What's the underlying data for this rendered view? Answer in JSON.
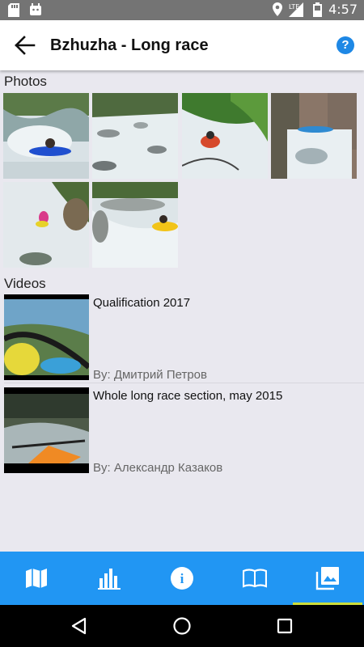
{
  "status": {
    "time": "4:57",
    "network": "LTE"
  },
  "appbar": {
    "title": "Bzhuzha - Long race",
    "help_label": "?"
  },
  "photos": {
    "label": "Photos",
    "items": [
      {
        "alt": "Kayaker in blue boat paddling whitewater"
      },
      {
        "alt": "Rapids flowing through forest"
      },
      {
        "alt": "Kayaker under trees in rapids"
      },
      {
        "alt": "Waterfall with kayakers"
      },
      {
        "alt": "Kayaker in white water"
      },
      {
        "alt": "Kayaker in yellow boat in rapids"
      }
    ]
  },
  "videos": {
    "label": "Videos",
    "items": [
      {
        "title": "Qualification 2017",
        "author": "By: Дмитрий Петров"
      },
      {
        "title": "Whole long race section, may 2015",
        "author": "By: Александр Казаков"
      }
    ]
  },
  "bottom_nav": {
    "items": [
      {
        "icon": "map-icon"
      },
      {
        "icon": "bar-chart-icon"
      },
      {
        "icon": "info-icon",
        "label": "i"
      },
      {
        "icon": "book-icon"
      },
      {
        "icon": "gallery-icon"
      }
    ],
    "active_index": 4
  },
  "colors": {
    "accent": "#2196f3",
    "active_indicator": "#cddc39",
    "help": "#1e88e5"
  }
}
